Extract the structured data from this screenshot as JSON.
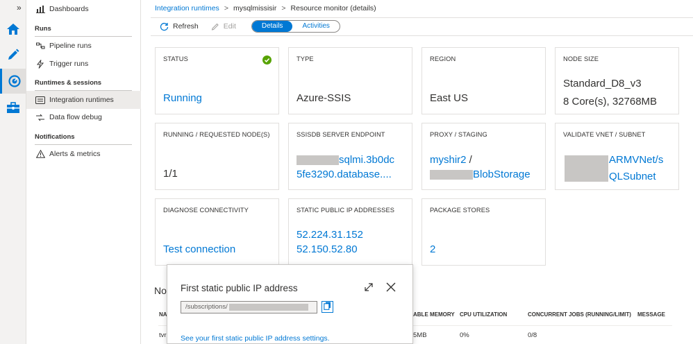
{
  "rail": {
    "expand_glyph": "»",
    "items": [
      {
        "icon": "home-icon"
      },
      {
        "icon": "pencil-icon"
      },
      {
        "icon": "monitor-gauge-icon",
        "active": true
      },
      {
        "icon": "toolbox-icon"
      }
    ]
  },
  "nav": {
    "dashboards": "Dashboards",
    "runs_header": "Runs",
    "pipeline_runs": "Pipeline runs",
    "trigger_runs": "Trigger runs",
    "runtimes_header": "Runtimes & sessions",
    "integration_runtimes": "Integration runtimes",
    "data_flow_debug": "Data flow debug",
    "notifications_header": "Notifications",
    "alerts_metrics": "Alerts & metrics"
  },
  "breadcrumb": {
    "root": "Integration runtimes",
    "mid": "mysqlmissisir",
    "current": "Resource monitor (details)",
    "separator": ">"
  },
  "toolbar": {
    "refresh": "Refresh",
    "edit": "Edit",
    "tab_details": "Details",
    "tab_activities": "Activities"
  },
  "cards": {
    "status": {
      "label": "STATUS",
      "value": "Running"
    },
    "type": {
      "label": "TYPE",
      "value": "Azure-SSIS"
    },
    "region": {
      "label": "REGION",
      "value": "East US"
    },
    "node_size": {
      "label": "NODE SIZE",
      "line1": "Standard_D8_v3",
      "line2": "8 Core(s), 32768MB"
    },
    "nodes": {
      "label": "RUNNING / REQUESTED NODE(S)",
      "value": "1/1"
    },
    "endpoint": {
      "label": "SSISDB SERVER ENDPOINT",
      "line1": "sqlmi.3b0dc",
      "line2": "5fe3290.database...."
    },
    "proxy": {
      "label": "PROXY / STAGING",
      "line1": "myshir2",
      "line1_sep": " /",
      "line2": "BlobStorage"
    },
    "vnet": {
      "label": "VALIDATE VNET / SUBNET",
      "line1": "ARMVNet/s",
      "line2": "QLSubnet"
    },
    "diagnose": {
      "label": "DIAGNOSE CONNECTIVITY",
      "value": "Test connection"
    },
    "static_ip": {
      "label": "STATIC PUBLIC IP ADDRESSES",
      "line1": "52.224.31.152",
      "line2": "52.150.52.80"
    },
    "package": {
      "label": "PACKAGE STORES",
      "value": "2"
    }
  },
  "nodes_section": {
    "title_partial": "No",
    "columns": {
      "name_partial": "NA",
      "memory_partial": "ABLE MEMORY",
      "cpu": "CPU UTILIZATION",
      "jobs": "CONCURRENT JOBS (RUNNING/LIMIT)",
      "message": "MESSAGE"
    },
    "row": {
      "name_partial": "tvr",
      "memory_partial": "5MB",
      "cpu": "0%",
      "jobs": "0/8"
    }
  },
  "popup": {
    "title": "First static public IP address",
    "input_prefix": "/subscriptions/",
    "link": "See your first static public IP address settings."
  },
  "colors": {
    "accent": "#0078d4",
    "success": "#57a300",
    "redaction": "#c8c6c4"
  }
}
